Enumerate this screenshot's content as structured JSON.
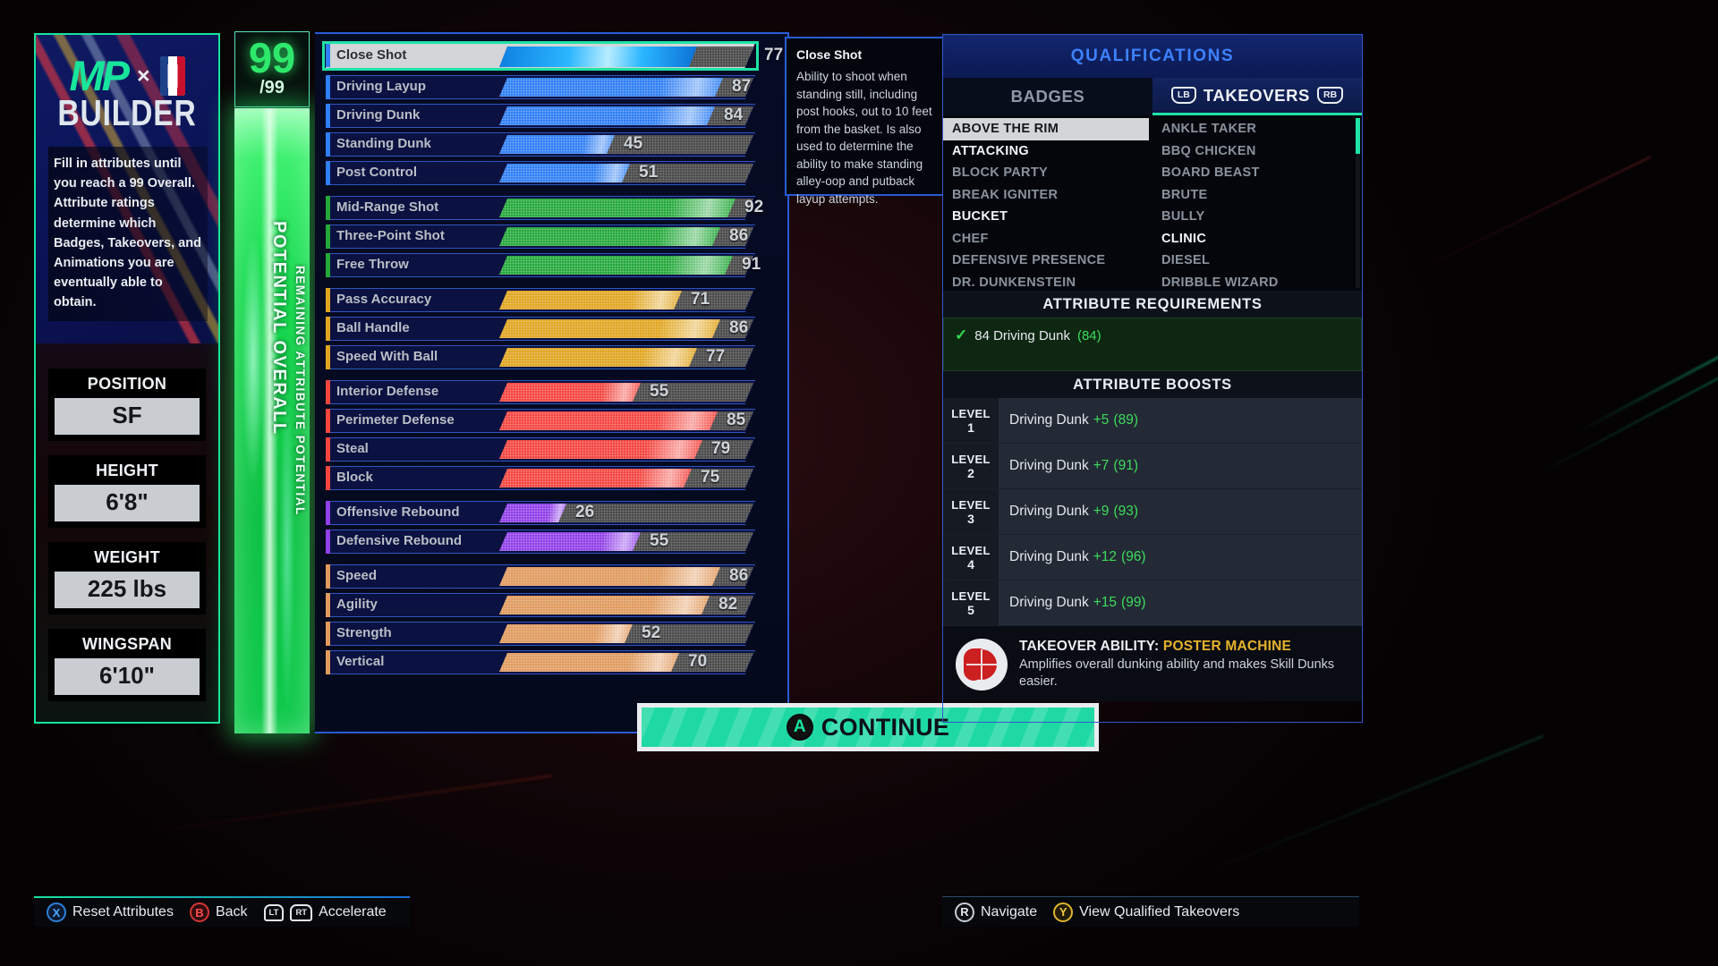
{
  "left_panel": {
    "logo_mp": "MP",
    "logo_x": "×",
    "logo_builder": "BUILDER",
    "description": "Fill in attributes until you reach a 99 Overall. Attribute ratings determine which Badges, Takeovers, and Animations you are eventually able to obtain.",
    "stats": [
      {
        "label": "POSITION",
        "value": "SF"
      },
      {
        "label": "HEIGHT",
        "value": "6'8\""
      },
      {
        "label": "WEIGHT",
        "value": "225 lbs"
      },
      {
        "label": "WINGSPAN",
        "value": "6'10\""
      }
    ]
  },
  "overall_meter": {
    "value": "99",
    "max": "/99",
    "label_primary": "POTENTIAL OVERALL",
    "label_secondary": "REMAINING ATTRIBUTE POTENTIAL",
    "fill_percent": 100,
    "color": "#2ee86b"
  },
  "attributes": {
    "selected": "Close Shot",
    "groups": [
      {
        "color": "#2f7ff5",
        "items": [
          {
            "name": "Close Shot",
            "value": 77,
            "selected": true
          },
          {
            "name": "Driving Layup",
            "value": 87
          },
          {
            "name": "Driving Dunk",
            "value": 84
          },
          {
            "name": "Standing Dunk",
            "value": 45
          },
          {
            "name": "Post Control",
            "value": 51
          }
        ]
      },
      {
        "color": "#24a83a",
        "items": [
          {
            "name": "Mid-Range Shot",
            "value": 92
          },
          {
            "name": "Three-Point Shot",
            "value": 86
          },
          {
            "name": "Free Throw",
            "value": 91
          }
        ]
      },
      {
        "color": "#e0a520",
        "items": [
          {
            "name": "Pass Accuracy",
            "value": 71
          },
          {
            "name": "Ball Handle",
            "value": 86
          },
          {
            "name": "Speed With Ball",
            "value": 77
          }
        ]
      },
      {
        "color": "#f4453f",
        "items": [
          {
            "name": "Interior Defense",
            "value": 55
          },
          {
            "name": "Perimeter Defense",
            "value": 85
          },
          {
            "name": "Steal",
            "value": 79
          },
          {
            "name": "Block",
            "value": 75
          }
        ]
      },
      {
        "color": "#9040e8",
        "items": [
          {
            "name": "Offensive Rebound",
            "value": 26
          },
          {
            "name": "Defensive Rebound",
            "value": 55
          }
        ]
      },
      {
        "color": "#e09a5e",
        "items": [
          {
            "name": "Speed",
            "value": 86
          },
          {
            "name": "Agility",
            "value": 82
          },
          {
            "name": "Strength",
            "value": 52
          },
          {
            "name": "Vertical",
            "value": 70
          }
        ]
      }
    ],
    "continue_label": "CONTINUE",
    "continue_button_glyph": "A"
  },
  "tooltip": {
    "title": "Close Shot",
    "body": "Ability to shoot when standing still, including post hooks, out to 10 feet from the basket. Is also used to determine the ability to make standing alley-oop and putback layup attempts."
  },
  "qualifications": {
    "title": "QUALIFICATIONS",
    "tabs": [
      {
        "label": "BADGES",
        "active": false
      },
      {
        "label": "TAKEOVERS",
        "active": true,
        "left_bumper": "LB",
        "right_bumper": "RB"
      }
    ],
    "badges": [
      {
        "name": "ABOVE THE RIM",
        "state": "selected"
      },
      {
        "name": "ATTACKING",
        "state": "bright"
      },
      {
        "name": "BLOCK PARTY",
        "state": "dim"
      },
      {
        "name": "BREAK IGNITER",
        "state": "dim"
      },
      {
        "name": "BUCKET",
        "state": "bright"
      },
      {
        "name": "CHEF",
        "state": "dim"
      },
      {
        "name": "DEFENSIVE PRESENCE",
        "state": "dim"
      },
      {
        "name": "DR. DUNKENSTEIN",
        "state": "dim"
      }
    ],
    "takeovers": [
      {
        "name": "ANKLE TAKER",
        "state": "dim"
      },
      {
        "name": "BBQ CHICKEN",
        "state": "dim"
      },
      {
        "name": "BOARD BEAST",
        "state": "dim"
      },
      {
        "name": "BRUTE",
        "state": "dim"
      },
      {
        "name": "BULLY",
        "state": "dim"
      },
      {
        "name": "CLINIC",
        "state": "bright"
      },
      {
        "name": "DIESEL",
        "state": "dim"
      },
      {
        "name": "DRIBBLE WIZARD",
        "state": "dim"
      }
    ],
    "requirements": {
      "title": "ATTRIBUTE REQUIREMENTS",
      "check_glyph": "✓",
      "text": "84 Driving Dunk",
      "current": "(84)"
    },
    "boosts": {
      "title": "ATTRIBUTE BOOSTS",
      "level_word": "LEVEL",
      "rows": [
        {
          "level": "1",
          "attribute": "Driving Dunk",
          "delta": "+5",
          "result": "(89)"
        },
        {
          "level": "2",
          "attribute": "Driving Dunk",
          "delta": "+7",
          "result": "(91)"
        },
        {
          "level": "3",
          "attribute": "Driving Dunk",
          "delta": "+9",
          "result": "(93)"
        },
        {
          "level": "4",
          "attribute": "Driving Dunk",
          "delta": "+12",
          "result": "(96)"
        },
        {
          "level": "5",
          "attribute": "Driving Dunk",
          "delta": "+15",
          "result": "(99)"
        }
      ]
    },
    "takeover_ability": {
      "prefix": "TAKEOVER ABILITY:",
      "name": "POSTER MACHINE",
      "description": "Amplifies overall dunking ability and makes Skill Dunks easier."
    }
  },
  "footer_left": [
    {
      "glyph": "X",
      "button": "x",
      "label": "Reset Attributes"
    },
    {
      "glyph": "B",
      "button": "b",
      "label": "Back"
    },
    {
      "glyph": "LT",
      "glyph2": "RT",
      "button": "trigger",
      "label": "Accelerate"
    }
  ],
  "footer_right": [
    {
      "glyph": "R",
      "button": "r",
      "label": "Navigate"
    },
    {
      "glyph": "Y",
      "button": "y",
      "label": "View Qualified Takeovers"
    }
  ]
}
